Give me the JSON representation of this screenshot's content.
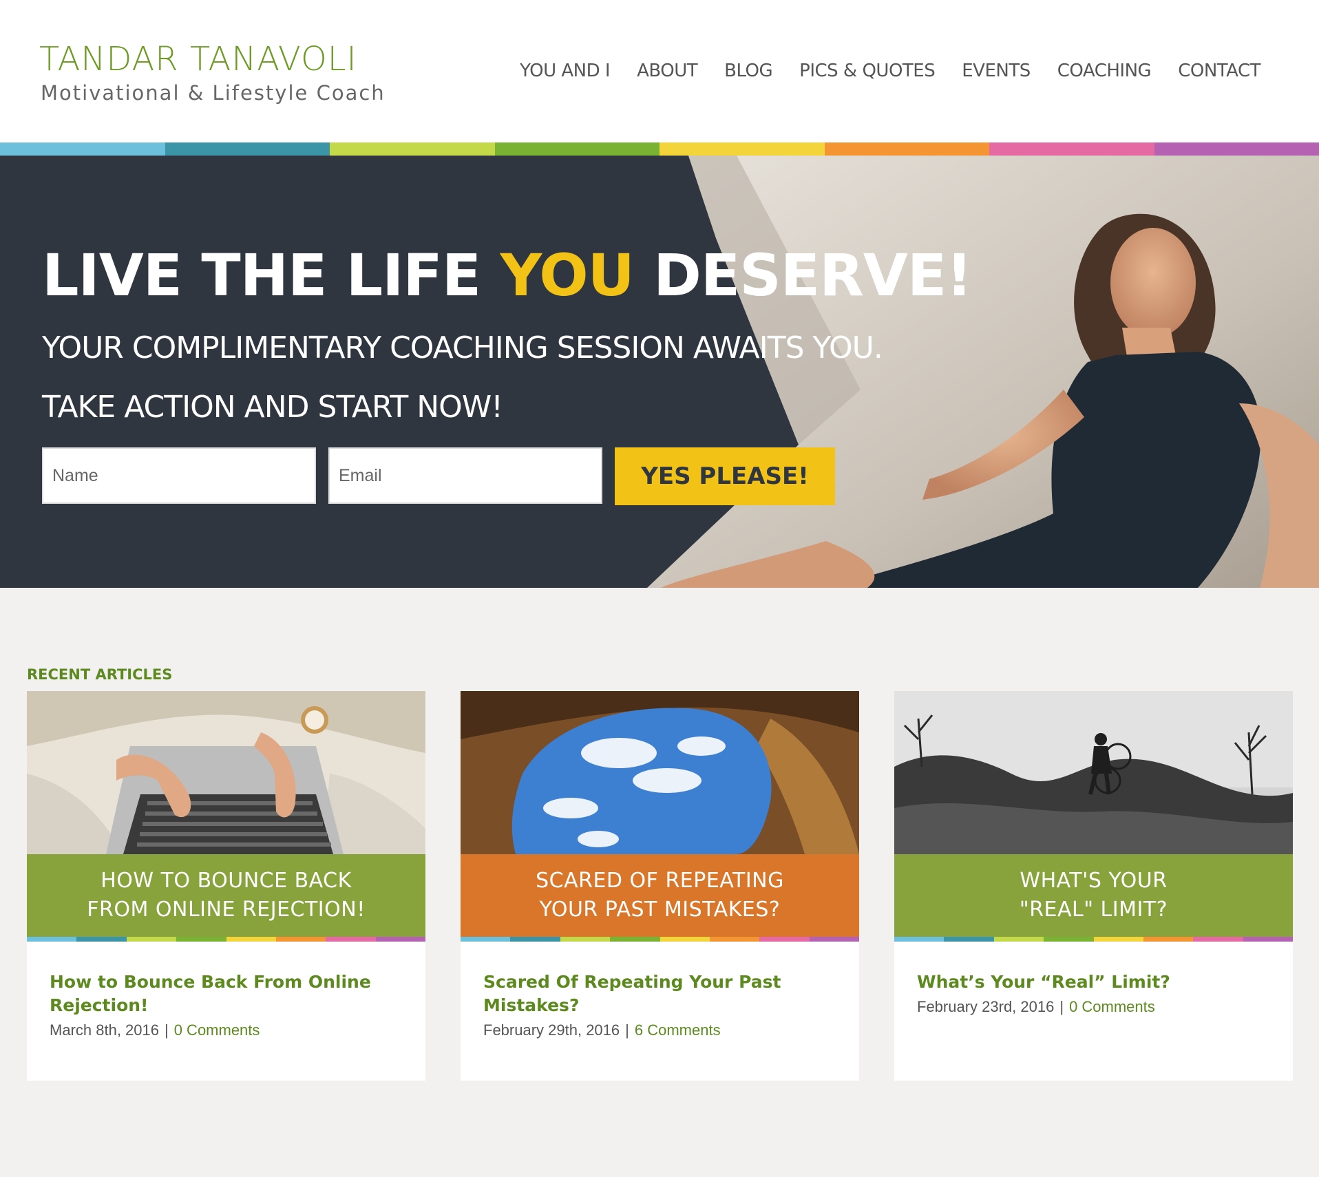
{
  "header": {
    "logo_title": "TANDAR TANAVOLI",
    "logo_subtitle": "Motivational & Lifestyle Coach",
    "nav": [
      "YOU AND I",
      "ABOUT",
      "BLOG",
      "PICS & QUOTES",
      "EVENTS",
      "COACHING",
      "CONTACT"
    ]
  },
  "colors": {
    "brand_green": "#6e9b26",
    "accent_yellow": "#f2c316",
    "hero_bg": "#2f3640",
    "stripe": [
      "#6dc0dc",
      "#3b95a7",
      "#c4d94a",
      "#7ab234",
      "#f3d43a",
      "#f29532",
      "#e56aa3",
      "#b562b3"
    ]
  },
  "hero": {
    "headline_pre": "LIVE THE LIFE ",
    "headline_accent": "YOU",
    "headline_post": " DESERVE!",
    "line2": "YOUR COMPLIMENTARY COACHING SESSION AWAITS YOU.",
    "line3": "TAKE ACTION AND START NOW!",
    "name_placeholder": "Name",
    "email_placeholder": "Email",
    "button_label": "YES PLEASE!"
  },
  "articles": {
    "label": "RECENT ARTICLES",
    "items": [
      {
        "band_text": "HOW TO BOUNCE BACK\nFROM ONLINE REJECTION!",
        "band_color": "#88a33b",
        "title": "How to Bounce Back From Online Rejection!",
        "date": "March 8th, 2016",
        "comments": "0 Comments",
        "image": "laptop-typing-image"
      },
      {
        "band_text": "SCARED OF REPEATING\nYOUR PAST MISTAKES?",
        "band_color": "#d9762a",
        "title": "Scared Of Repeating Your Past Mistakes?",
        "date": "February 29th, 2016",
        "comments": "6 Comments",
        "image": "cave-sky-image"
      },
      {
        "band_text": "WHAT'S YOUR\n\"REAL\" LIMIT?",
        "band_color": "#88a33b",
        "title": "What’s Your “Real” Limit?",
        "date": "February 23rd, 2016",
        "comments": "0 Comments",
        "image": "cyclist-hill-image"
      }
    ]
  }
}
